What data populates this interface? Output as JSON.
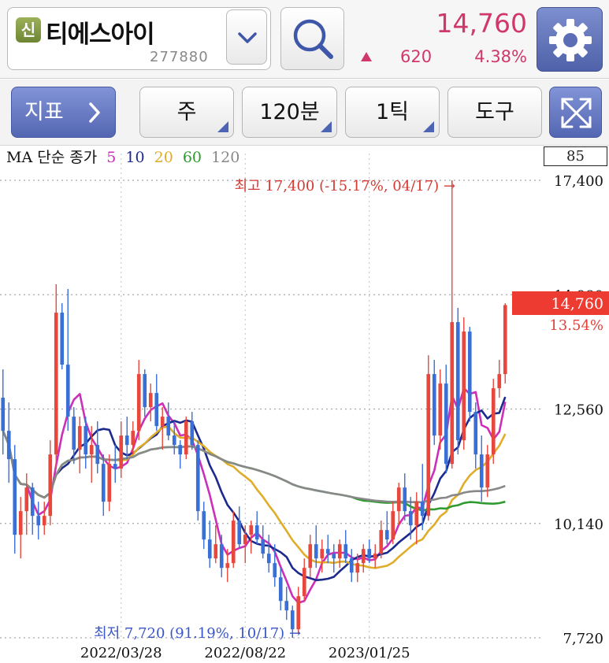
{
  "header": {
    "badge": "신",
    "stock_name": "티에스아이",
    "stock_code": "277880",
    "price": "14,760",
    "change": "620",
    "change_pct": "4.38%",
    "icons": {
      "dropdown": "chevron-down-icon",
      "search": "search-icon",
      "settings": "gear-icon"
    },
    "colors": {
      "up": "#d0376b"
    }
  },
  "toolbar": {
    "indicator_label": "지표",
    "period_label": "주",
    "interval_label": "120분",
    "tick_label": "1틱",
    "tools_label": "도구",
    "expand_icon": "expand-icon"
  },
  "legend": {
    "ma_prefix": "MA 단순 종가",
    "periods": [
      {
        "label": "5",
        "color": "#cc2fb8"
      },
      {
        "label": "10",
        "color": "#1b2a8c"
      },
      {
        "label": "20",
        "color": "#e0ad2a"
      },
      {
        "label": "60",
        "color": "#2f9a2f"
      },
      {
        "label": "120",
        "color": "#888888"
      }
    ],
    "box_value": "85"
  },
  "chart_data": {
    "type": "candlestick",
    "y_ticks": [
      "17,400",
      "14,980",
      "12,560",
      "10,140",
      "7,720"
    ],
    "ylim": [
      7720,
      17400
    ],
    "x_ticks": [
      {
        "label": "2022/03/28",
        "index": 20
      },
      {
        "label": "2022/08/22",
        "index": 41
      },
      {
        "label": "2023/01/25",
        "index": 62
      }
    ],
    "current_price": "14,760",
    "current_pct": "13.54%",
    "max_annotation": "최고 17,400 (-15.17%, 04/17) →",
    "min_annotation": "최저 7,720 (91.19%, 10/17) →",
    "max_index": 76,
    "min_index": 49,
    "colors": {
      "up": "#e8473d",
      "down": "#3a6fd6",
      "current_bg": "#ee3b32"
    },
    "candles": [
      [
        12800,
        13400,
        11600,
        12100
      ],
      [
        12100,
        12700,
        11000,
        11500
      ],
      [
        11500,
        11800,
        9500,
        9900
      ],
      [
        9900,
        10700,
        9400,
        10400
      ],
      [
        10400,
        11200,
        9900,
        10900
      ],
      [
        10900,
        11000,
        9900,
        10300
      ],
      [
        10300,
        10600,
        9800,
        10100
      ],
      [
        10100,
        10600,
        9900,
        10300
      ],
      [
        10300,
        11900,
        10100,
        11600
      ],
      [
        11600,
        15200,
        11300,
        14600
      ],
      [
        14600,
        14800,
        13400,
        13500
      ],
      [
        13500,
        15100,
        12100,
        12400
      ],
      [
        12400,
        12600,
        11400,
        11700
      ],
      [
        11700,
        12400,
        11200,
        12200
      ],
      [
        12200,
        12400,
        11300,
        11600
      ],
      [
        11600,
        12200,
        11000,
        11800
      ],
      [
        11800,
        12300,
        11200,
        11400
      ],
      [
        11400,
        11600,
        10300,
        10600
      ],
      [
        10600,
        11600,
        10400,
        11400
      ],
      [
        11400,
        11800,
        11000,
        11300
      ],
      [
        11300,
        12300,
        11100,
        12000
      ],
      [
        12000,
        12400,
        11500,
        11800
      ],
      [
        11800,
        12300,
        11600,
        12100
      ],
      [
        12100,
        13600,
        11900,
        13300
      ],
      [
        13300,
        13400,
        12400,
        12600
      ],
      [
        12600,
        13100,
        12300,
        12900
      ],
      [
        12900,
        13300,
        12100,
        12200
      ],
      [
        12200,
        12600,
        11700,
        12400
      ],
      [
        12400,
        12700,
        11900,
        12000
      ],
      [
        12000,
        12300,
        11600,
        11800
      ],
      [
        11800,
        11900,
        11300,
        11600
      ],
      [
        11600,
        12400,
        11500,
        12300
      ],
      [
        12300,
        12500,
        11700,
        11800
      ],
      [
        11800,
        11900,
        10200,
        10400
      ],
      [
        10400,
        10600,
        9600,
        9800
      ],
      [
        9800,
        10200,
        9200,
        9400
      ],
      [
        9400,
        10100,
        9300,
        9700
      ],
      [
        9700,
        9900,
        9000,
        9200
      ],
      [
        9200,
        9600,
        8900,
        9300
      ],
      [
        9300,
        10400,
        9200,
        10200
      ],
      [
        10200,
        10500,
        9600,
        9700
      ],
      [
        9700,
        10100,
        9300,
        9900
      ],
      [
        9900,
        10200,
        9500,
        10100
      ],
      [
        10100,
        10400,
        9700,
        9800
      ],
      [
        9800,
        10100,
        9400,
        9500
      ],
      [
        9500,
        9900,
        9100,
        9300
      ],
      [
        9300,
        9700,
        8800,
        9000
      ],
      [
        9000,
        9200,
        8300,
        8500
      ],
      [
        8500,
        8800,
        8100,
        8300
      ],
      [
        8300,
        8400,
        7720,
        7900
      ],
      [
        7900,
        8800,
        7800,
        8600
      ],
      [
        8600,
        9400,
        8500,
        9200
      ],
      [
        9200,
        9900,
        9000,
        9700
      ],
      [
        9700,
        10100,
        9200,
        9400
      ],
      [
        9400,
        9800,
        9100,
        9600
      ],
      [
        9600,
        9900,
        9300,
        9500
      ],
      [
        9500,
        9700,
        9100,
        9400
      ],
      [
        9400,
        9800,
        9200,
        9700
      ],
      [
        9700,
        10000,
        9300,
        9400
      ],
      [
        9400,
        9600,
        8900,
        9100
      ],
      [
        9100,
        9500,
        8900,
        9300
      ],
      [
        9300,
        9700,
        9100,
        9600
      ],
      [
        9600,
        9800,
        9300,
        9400
      ],
      [
        9400,
        9700,
        9200,
        9500
      ],
      [
        9500,
        10200,
        9400,
        10000
      ],
      [
        10000,
        10400,
        9700,
        9800
      ],
      [
        9800,
        10600,
        9700,
        10400
      ],
      [
        10400,
        11000,
        10100,
        10900
      ],
      [
        10900,
        11200,
        10200,
        10400
      ],
      [
        10400,
        10700,
        9800,
        10100
      ],
      [
        10100,
        10800,
        9700,
        10600
      ],
      [
        10600,
        11400,
        10000,
        10300
      ],
      [
        10300,
        13700,
        10200,
        13300
      ],
      [
        13300,
        13600,
        11800,
        12000
      ],
      [
        12000,
        13400,
        11700,
        13100
      ],
      [
        13100,
        13500,
        11200,
        11400
      ],
      [
        11400,
        17400,
        11300,
        14400
      ],
      [
        14400,
        14700,
        11600,
        11900
      ],
      [
        11900,
        14500,
        11700,
        14200
      ],
      [
        14200,
        14300,
        12300,
        12500
      ],
      [
        12500,
        12700,
        11300,
        11600
      ],
      [
        11600,
        12000,
        10600,
        10900
      ],
      [
        10900,
        11800,
        10700,
        11600
      ],
      [
        11600,
        13200,
        11400,
        13000
      ],
      [
        13000,
        13600,
        12800,
        13300
      ],
      [
        13300,
        14800,
        13100,
        14760
      ]
    ]
  }
}
